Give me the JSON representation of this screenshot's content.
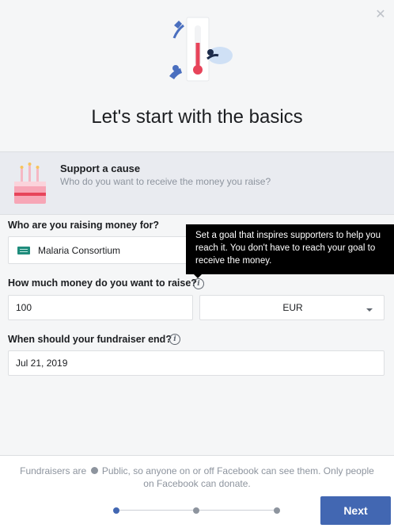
{
  "dialog": {
    "title": "Let's start with the basics",
    "close_icon": "close-icon"
  },
  "cause": {
    "title": "Support a cause",
    "subtitle": "Who do you want to receive the money you raise?",
    "icon": "birthday-cake-icon"
  },
  "recipient": {
    "label": "Who are you raising money for?",
    "value": "Malaria Consortium",
    "icon": "charity-icon"
  },
  "tooltip": {
    "text": "Set a goal that inspires supporters to help you reach it. You don't have to reach your goal to receive the money."
  },
  "goal": {
    "label": "How much money do you want to raise?",
    "amount": "100",
    "currency": "EUR",
    "info_icon": "info-icon"
  },
  "end_date": {
    "label": "When should your fundraiser end?",
    "value": "Jul 21, 2019",
    "info_icon": "info-icon"
  },
  "footer": {
    "text_before": "Fundraisers are",
    "text_after": "Public, so anyone on or off Facebook can see them. Only people on Facebook can donate.",
    "globe_icon": "globe-icon",
    "next_label": "Next",
    "steps_total": 3,
    "current_step": 1
  },
  "colors": {
    "accent": "#4267b2",
    "thermometer": "#e7445a",
    "figure_blue": "#4a6fbf"
  }
}
